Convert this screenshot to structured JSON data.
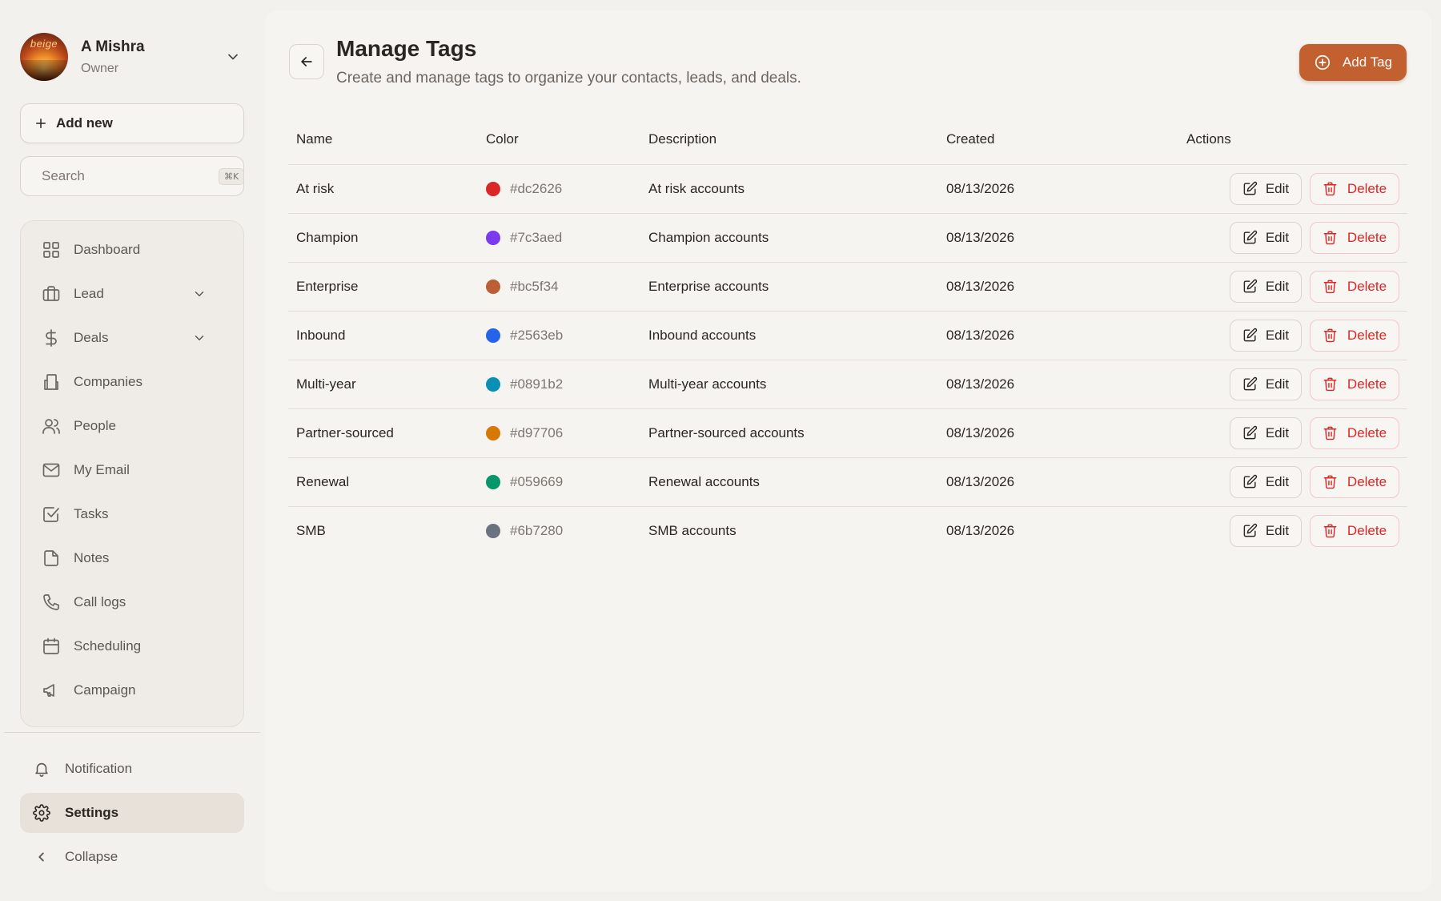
{
  "user": {
    "name": "A Mishra",
    "role": "Owner",
    "avatar_text": "beige"
  },
  "sidebar": {
    "add_new_label": "Add new",
    "search_placeholder": "Search",
    "search_shortcut": "⌘K",
    "items": [
      {
        "label": "Dashboard",
        "icon": "dashboard-icon"
      },
      {
        "label": "Lead",
        "icon": "briefcase-icon",
        "expandable": true
      },
      {
        "label": "Deals",
        "icon": "dollar-icon",
        "expandable": true
      },
      {
        "label": "Companies",
        "icon": "building-icon"
      },
      {
        "label": "People",
        "icon": "users-icon"
      },
      {
        "label": "My Email",
        "icon": "mail-icon"
      },
      {
        "label": "Tasks",
        "icon": "checkbox-icon"
      },
      {
        "label": "Notes",
        "icon": "note-icon"
      },
      {
        "label": "Call logs",
        "icon": "phone-icon"
      },
      {
        "label": "Scheduling",
        "icon": "calendar-icon"
      },
      {
        "label": "Campaign",
        "icon": "megaphone-icon"
      }
    ],
    "bottom": {
      "notification_label": "Notification",
      "settings_label": "Settings",
      "collapse_label": "Collapse"
    }
  },
  "page": {
    "title": "Manage Tags",
    "subtitle": "Create and manage tags to organize your contacts, leads, and deals.",
    "add_tag_label": "Add Tag",
    "accent_color": "#c2612f"
  },
  "table": {
    "headers": {
      "name": "Name",
      "color": "Color",
      "description": "Description",
      "created": "Created",
      "actions": "Actions"
    },
    "edit_label": "Edit",
    "delete_label": "Delete",
    "rows": [
      {
        "name": "At risk",
        "color": "#dc2626",
        "description": "At risk accounts",
        "created": "08/13/2026"
      },
      {
        "name": "Champion",
        "color": "#7c3aed",
        "description": "Champion accounts",
        "created": "08/13/2026"
      },
      {
        "name": "Enterprise",
        "color": "#bc5f34",
        "description": "Enterprise accounts",
        "created": "08/13/2026"
      },
      {
        "name": "Inbound",
        "color": "#2563eb",
        "description": "Inbound accounts",
        "created": "08/13/2026"
      },
      {
        "name": "Multi-year",
        "color": "#0891b2",
        "description": "Multi-year accounts",
        "created": "08/13/2026"
      },
      {
        "name": "Partner-sourced",
        "color": "#d97706",
        "description": "Partner-sourced accounts",
        "created": "08/13/2026"
      },
      {
        "name": "Renewal",
        "color": "#059669",
        "description": "Renewal accounts",
        "created": "08/13/2026"
      },
      {
        "name": "SMB",
        "color": "#6b7280",
        "description": "SMB accounts",
        "created": "08/13/2026"
      }
    ]
  }
}
